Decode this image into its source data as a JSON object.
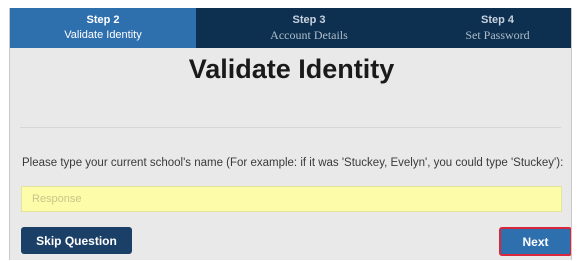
{
  "steps": [
    {
      "number": "Step 2",
      "label": "Validate Identity"
    },
    {
      "number": "Step 3",
      "label": "Account Details"
    },
    {
      "number": "Step 4",
      "label": "Set Password"
    }
  ],
  "page_title": "Validate Identity",
  "question": "Please type your current school's name (For example: if it was 'Stuckey, Evelyn', you could type 'Stuckey'):",
  "response": {
    "placeholder": "Response",
    "value": ""
  },
  "buttons": {
    "skip": "Skip Question",
    "next": "Next"
  },
  "colors": {
    "active_step": "#2e6fae",
    "header_bar": "#0e3050",
    "response_bg": "#fcfca9",
    "next_border": "#d8263c"
  }
}
